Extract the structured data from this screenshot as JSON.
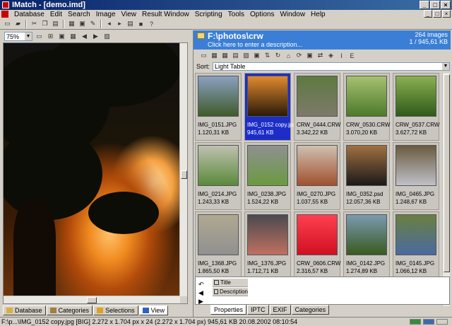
{
  "window": {
    "title": "IMatch - [demo.imd]"
  },
  "menu": [
    "Database",
    "Edit",
    "Search",
    "Image",
    "View",
    "Result Window",
    "Scripting",
    "Tools",
    "Options",
    "Window",
    "Help"
  ],
  "viewer": {
    "zoom": "75%",
    "tabs": [
      "Database",
      "Categories",
      "Selections",
      "View"
    ],
    "active_tab": "View"
  },
  "folder": {
    "path": "F:\\photos\\crw",
    "description_prompt": "Click here to enter a description...",
    "image_count": "264 images",
    "size_info": "1 / 945,61 KB"
  },
  "sort": {
    "label": "Sort:",
    "value": "Light Table"
  },
  "thumbnails": [
    {
      "name": "IMG_0151.JPG",
      "size": "1.120,31 KB",
      "colors": [
        "#3f5b2a",
        "#8aa0c0"
      ],
      "selected": false
    },
    {
      "name": "IMG_0152 copy.jpg",
      "size": "945,61 KB",
      "colors": [
        "#2a1a08",
        "#e08a30"
      ],
      "selected": true
    },
    {
      "name": "CRW_0444.CRW",
      "size": "3.342,22 KB",
      "colors": [
        "#7d7a6a",
        "#5e7a40"
      ],
      "selected": false
    },
    {
      "name": "CRW_0530.CRW",
      "size": "3.070,20 KB",
      "colors": [
        "#4d7a2a",
        "#a6c070"
      ],
      "selected": false
    },
    {
      "name": "CRW_0537.CRW",
      "size": "3.627,72 KB",
      "colors": [
        "#2f5a1a",
        "#8ab050"
      ],
      "selected": false
    },
    {
      "name": "IMG_0214.JPG",
      "size": "1.243,33 KB",
      "colors": [
        "#5a8a3a",
        "#c0c0b0"
      ],
      "selected": false
    },
    {
      "name": "IMG_0238.JPG",
      "size": "1.524,22 KB",
      "colors": [
        "#6a9a40",
        "#909090"
      ],
      "selected": false
    },
    {
      "name": "IMG_0270.JPG",
      "size": "1.037,55 KB",
      "colors": [
        "#a05030",
        "#d0c0b0"
      ],
      "selected": false
    },
    {
      "name": "IMG_0352.psd",
      "size": "12.057,36 KB",
      "colors": [
        "#1a1a1a",
        "#a07040"
      ],
      "selected": false
    },
    {
      "name": "IMG_0465.JPG",
      "size": "1.248,67 KB",
      "colors": [
        "#c0c0c8",
        "#6a5a40"
      ],
      "selected": false
    },
    {
      "name": "IMG_1368.JPG",
      "size": "1.865,50 KB",
      "colors": [
        "#909090",
        "#b0a890"
      ],
      "selected": false
    },
    {
      "name": "IMG_1376.JPG",
      "size": "1.712,71 KB",
      "colors": [
        "#c07060",
        "#4a4a50"
      ],
      "selected": false
    },
    {
      "name": "CRW_0606.CRW",
      "size": "2.316,57 KB",
      "colors": [
        "#d01020",
        "#ff4050"
      ],
      "selected": false
    },
    {
      "name": "IMG_0142.JPG",
      "size": "1.274,89 KB",
      "colors": [
        "#3a5a20",
        "#7a9ab0"
      ],
      "selected": false
    },
    {
      "name": "IMG_0145.JPG",
      "size": "1.066,12 KB",
      "colors": [
        "#4a6aa0",
        "#6a8040"
      ],
      "selected": false
    }
  ],
  "properties": {
    "fields": [
      "Title",
      "Description"
    ],
    "tabs": [
      "Properties",
      "IPTC",
      "EXIF",
      "Categories"
    ],
    "active_tab": "Properties"
  },
  "status": {
    "text": "F:\\p...\\IMG_0152 copy.jpg [BIG] 2.272 x 1.704 px x 24 (2.272 x 1.704 px)   945,61 KB  20.08.2002 08:10:54"
  }
}
